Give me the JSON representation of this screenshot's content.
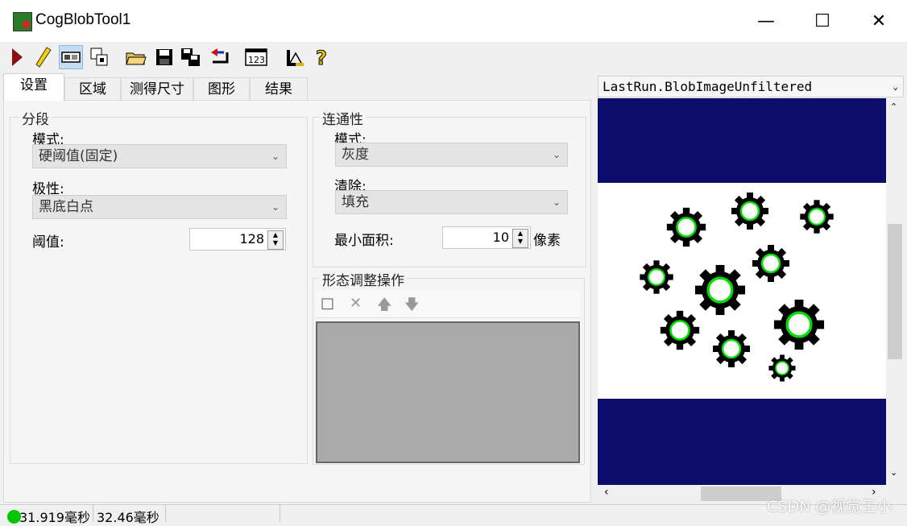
{
  "window": {
    "title": "CogBlobTool1",
    "minimize": "—",
    "maximize": "☐",
    "close": "✕"
  },
  "toolbar": {
    "icons": [
      "run-icon",
      "electric-icon",
      "display-icon",
      "floating-icon",
      "open-icon",
      "save-icon",
      "save-as-icon",
      "reset-icon",
      "numeric-icon",
      "measure-icon",
      "help-icon"
    ]
  },
  "tabs": [
    "设置",
    "区域",
    "测得尺寸",
    "图形",
    "结果"
  ],
  "segment": {
    "group_label": "分段",
    "mode_label": "模式:",
    "mode_value": "硬阈值(固定)",
    "polarity_label": "极性:",
    "polarity_value": "黑底白点",
    "threshold_label": "阈值:",
    "threshold_value": "128"
  },
  "connectivity": {
    "group_label": "连通性",
    "mode_label": "模式:",
    "mode_value": "灰度",
    "clean_label": "清除:",
    "clean_value": "填充",
    "min_area_label": "最小面积:",
    "min_area_value": "10",
    "unit": "像素"
  },
  "morphology": {
    "group_label": "形态调整操作"
  },
  "image_panel": {
    "selector": "LastRun.BlobImageUnfiltered"
  },
  "status": {
    "time1": "31.919毫秒",
    "time2": "32.46毫秒",
    "indicator_color": "#00c800"
  },
  "watermark": "CSDN @视觉王小"
}
